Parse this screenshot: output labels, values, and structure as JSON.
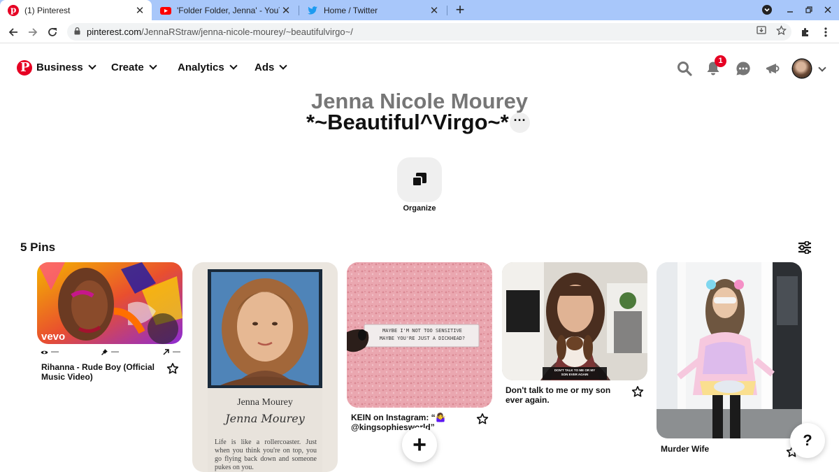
{
  "browser": {
    "tabs": [
      {
        "title": "(1) Pinterest",
        "close": "✕",
        "active": true,
        "favicon_color": "#e60023"
      },
      {
        "title": "'Folder Folder, Jenna' - YouTube",
        "close": "✕",
        "active": false,
        "favicon_color": "#ff0000"
      },
      {
        "title": "Home / Twitter",
        "close": "✕",
        "active": false,
        "favicon_color": "#1d9bf0"
      }
    ],
    "new_tab": "+",
    "url_domain": "pinterest.com",
    "url_path": "/JennaRStraw/jenna-nicole-mourey/~beautifulvirgo~/"
  },
  "header": {
    "logo": "P",
    "menu": [
      "Business",
      "Create",
      "Analytics",
      "Ads"
    ],
    "notification_count": "1",
    "icons": [
      "search-icon",
      "bell-icon",
      "chat-icon",
      "megaphone-icon"
    ]
  },
  "board": {
    "owner": "Jenna Nicole Mourey",
    "title": "*~Beautiful^Virgo~*",
    "more": "···",
    "organize_label": "Organize",
    "pin_count": "5 Pins"
  },
  "pins": [
    {
      "title": "Rihanna - Rude Boy (Official Music Video)",
      "stats": [
        "—",
        "—",
        "—"
      ],
      "overlay": "vevo"
    },
    {
      "title": "",
      "yearbook": {
        "name": "Jenna Mourey",
        "signature": "Jenna Mourey",
        "quote": "Life is like a rollercoaster.  Just when you think you're on top, you go flying back down and someone pukes on you."
      }
    },
    {
      "title": "KEIN on Instagram: “🤷‍♀️ @kingsophiesworld”",
      "sign_text": [
        "MAYBE I'M NOT TOO SENSITIVE",
        "MAYBE YOU'RE JUST A DICKHEAD?"
      ]
    },
    {
      "title": "Don't talk to me or my son ever again.",
      "caption": "DON'T TALK TO ME OR MY SON EVER AGAIN"
    },
    {
      "title": "Murder Wife"
    }
  ],
  "fab": {
    "add": "+",
    "help": "?"
  },
  "colors": {
    "brand": "#e60023",
    "tabbar": "#a8c7fa"
  }
}
